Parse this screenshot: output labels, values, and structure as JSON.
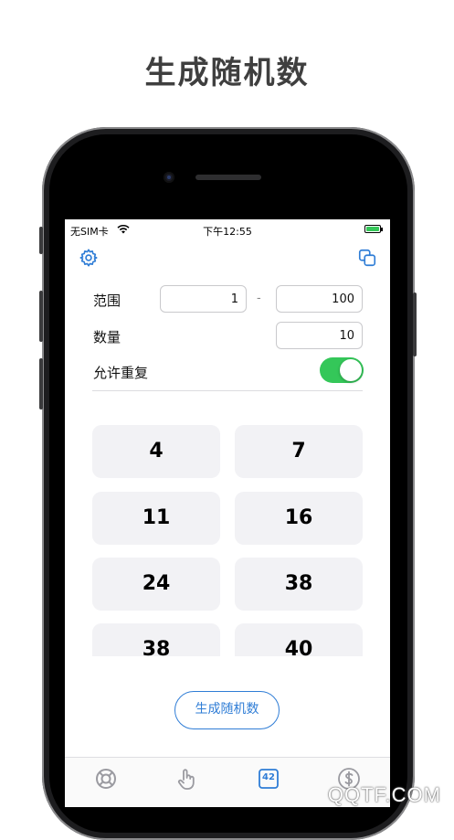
{
  "headline": "生成随机数",
  "status_bar": {
    "carrier": "无SIM卡",
    "time": "下午12:55"
  },
  "toolbar": {
    "settings_icon": "gear-icon",
    "copy_icon": "copy-icon"
  },
  "form": {
    "range_label": "范围",
    "range_min": "1",
    "range_separator": "-",
    "range_max": "100",
    "count_label": "数量",
    "count_value": "10",
    "allow_repeat_label": "允许重复",
    "allow_repeat_on": true
  },
  "results": [
    "4",
    "7",
    "11",
    "16",
    "24",
    "38",
    "38",
    "40"
  ],
  "generate_button": "生成随机数",
  "tabs": [
    {
      "icon": "lifebuoy-icon",
      "active": false
    },
    {
      "icon": "hand-tap-icon",
      "active": false
    },
    {
      "icon": "number-42-icon",
      "label": "42",
      "active": true
    },
    {
      "icon": "dollar-coin-icon",
      "active": false
    }
  ],
  "watermark": "QQTF.COM",
  "colors": {
    "accent": "#2f7dd6",
    "toggle_on": "#34c759",
    "cell_bg": "#f2f2f5"
  }
}
